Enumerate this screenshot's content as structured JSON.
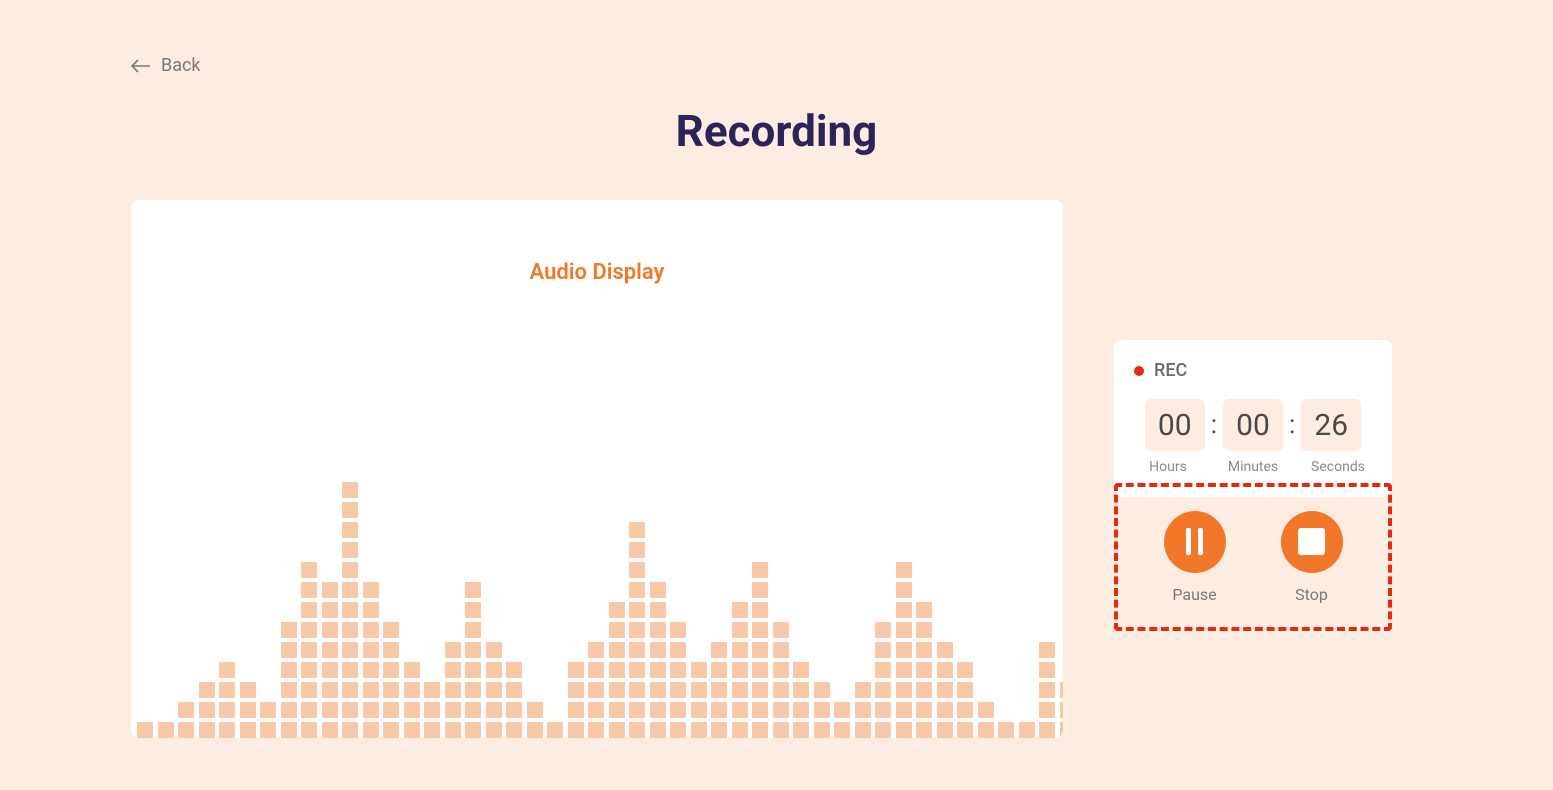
{
  "nav": {
    "back_label": "Back"
  },
  "page": {
    "title": "Recording"
  },
  "audio": {
    "display_label": "Audio Display",
    "equalizer_heights": [
      1,
      1,
      2,
      3,
      4,
      3,
      2,
      6,
      9,
      8,
      13,
      8,
      6,
      4,
      3,
      5,
      8,
      5,
      4,
      2,
      1,
      4,
      5,
      7,
      11,
      8,
      6,
      4,
      5,
      7,
      9,
      6,
      4,
      3,
      2,
      3,
      6,
      9,
      7,
      5,
      4,
      2,
      1,
      1,
      5,
      3
    ]
  },
  "recorder": {
    "status_label": "REC",
    "colon": ":",
    "time": {
      "hours": "00",
      "minutes": "00",
      "seconds": "26"
    },
    "units": {
      "hours_label": "Hours",
      "minutes_label": "Minutes",
      "seconds_label": "Seconds"
    }
  },
  "controls": {
    "pause_label": "Pause",
    "stop_label": "Stop"
  }
}
